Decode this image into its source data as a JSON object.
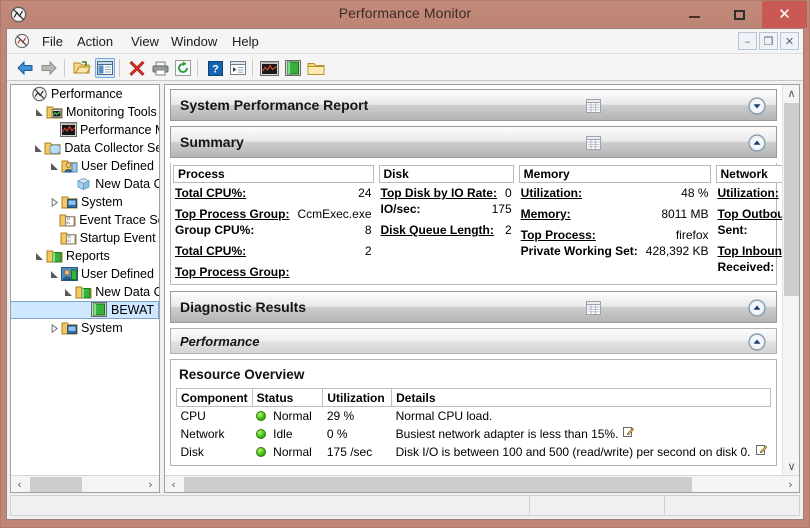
{
  "window": {
    "title": "Performance Monitor",
    "icon": "performance-monitor-icon",
    "minimize": "–",
    "maximize": "❑",
    "close": "✕"
  },
  "menu": {
    "items": [
      {
        "label": "File"
      },
      {
        "label": "Action"
      },
      {
        "label": "View"
      },
      {
        "label": "Window"
      },
      {
        "label": "Help"
      }
    ],
    "mdi_buttons": [
      {
        "name": "mdi-minimize-button",
        "glyph": "–"
      },
      {
        "name": "mdi-restore-button",
        "glyph": "❐"
      },
      {
        "name": "mdi-close-button",
        "glyph": "✕"
      }
    ]
  },
  "toolbar": {
    "items": [
      {
        "name": "back-button",
        "icon": "back-arrow-icon"
      },
      {
        "name": "forward-button",
        "icon": "forward-arrow-icon"
      },
      {
        "name": "open-folder-button",
        "icon": "open-folder-icon"
      },
      {
        "name": "show-console-tree-button",
        "icon": "console-tree-icon",
        "selected": true
      },
      {
        "name": "delete-button",
        "icon": "red-x-icon"
      },
      {
        "name": "print-button",
        "icon": "printer-icon"
      },
      {
        "name": "refresh-button",
        "icon": "refresh-icon"
      },
      {
        "name": "help-button",
        "icon": "question-mark-icon"
      },
      {
        "name": "properties-button",
        "icon": "properties-icon"
      },
      {
        "name": "performance-monitor-button",
        "icon": "performance-graph-icon"
      },
      {
        "name": "report-button",
        "icon": "green-report-icon"
      },
      {
        "name": "new-folder-button",
        "icon": "yellow-folder-icon"
      }
    ]
  },
  "tree": {
    "nodes": [
      {
        "label": "Performance",
        "indent": 0,
        "expander": "none",
        "icon": "performance-root-icon",
        "selected": false
      },
      {
        "label": "Monitoring Tools",
        "indent": 1,
        "expander": "expanded",
        "icon": "folder-green-graph-icon",
        "selected": false
      },
      {
        "label": "Performance M",
        "indent": 2,
        "expander": "none",
        "icon": "perf-monitor-graph-icon",
        "selected": false
      },
      {
        "label": "Data Collector Sets",
        "indent": 1,
        "expander": "expanded",
        "icon": "folder-collector-icon",
        "selected": false
      },
      {
        "label": "User Defined",
        "indent": 2,
        "expander": "expanded",
        "icon": "user-defined-icon",
        "selected": false
      },
      {
        "label": "New Data C",
        "indent": 3,
        "expander": "none",
        "icon": "data-collector-cube-icon",
        "selected": false
      },
      {
        "label": "System",
        "indent": 2,
        "expander": "collapsed",
        "icon": "folder-system-icon",
        "selected": false
      },
      {
        "label": "Event Trace Ses",
        "indent": 2,
        "expander": "none",
        "icon": "folder-event-trace-icon",
        "selected": false
      },
      {
        "label": "Startup Event T",
        "indent": 2,
        "expander": "none",
        "icon": "folder-event-trace-icon",
        "selected": false
      },
      {
        "label": "Reports",
        "indent": 1,
        "expander": "expanded",
        "icon": "folder-reports-icon",
        "selected": false
      },
      {
        "label": "User Defined",
        "indent": 2,
        "expander": "expanded",
        "icon": "reports-user-defined-icon",
        "selected": false
      },
      {
        "label": "New Data C",
        "indent": 3,
        "expander": "expanded",
        "icon": "folder-reports-icon",
        "selected": false
      },
      {
        "label": "BEWAT",
        "indent": 4,
        "expander": "none",
        "icon": "green-report-icon",
        "selected": true
      },
      {
        "label": "System",
        "indent": 2,
        "expander": "collapsed",
        "icon": "folder-system-icon",
        "selected": false
      }
    ]
  },
  "report": {
    "main_header": {
      "title": "System Performance Report",
      "collapsed": true
    },
    "summary": {
      "title": "Summary",
      "collapsed": false,
      "columns": [
        {
          "header": "Process",
          "rows": [
            {
              "key": "Total CPU%:",
              "value": "24",
              "style": "underline"
            },
            {
              "key": "",
              "value": "",
              "style": "gap"
            },
            {
              "key": "Top Process Group:",
              "value": "CcmExec.exe",
              "style": "underline"
            },
            {
              "key": "Group CPU%:",
              "value": "8",
              "style": "bold"
            },
            {
              "key": "",
              "value": "",
              "style": "gap"
            },
            {
              "key": "Total CPU%:",
              "value": "2",
              "style": "underline"
            },
            {
              "key": "",
              "value": "",
              "style": "gap"
            },
            {
              "key": "Top Process Group:",
              "value": "",
              "style": "underline"
            }
          ]
        },
        {
          "header": "Disk",
          "rows": [
            {
              "key": "Top Disk by IO Rate:",
              "value": "0",
              "style": "underline"
            },
            {
              "key": "IO/sec:",
              "value": "175",
              "style": "bold"
            },
            {
              "key": "",
              "value": "",
              "style": "gap"
            },
            {
              "key": "Disk Queue Length:",
              "value": "2",
              "style": "underline"
            }
          ]
        },
        {
          "header": "Memory",
          "rows": [
            {
              "key": "Utilization:",
              "value": "48 %",
              "style": "underline"
            },
            {
              "key": "",
              "value": "",
              "style": "gap"
            },
            {
              "key": "Memory:",
              "value": "8011 MB",
              "style": "underline"
            },
            {
              "key": "",
              "value": "",
              "style": "gap"
            },
            {
              "key": "Top Process:",
              "value": "firefox",
              "style": "underline"
            },
            {
              "key": "Private Working Set:",
              "value": "428,392 KB",
              "style": "bold"
            }
          ]
        },
        {
          "header": "Network",
          "rows": [
            {
              "key": "Utilization:",
              "value": "",
              "style": "underline"
            },
            {
              "key": "",
              "value": "",
              "style": "gap"
            },
            {
              "key": "Top Outbound Client:",
              "value": "",
              "style": "underline"
            },
            {
              "key": "Sent:",
              "value": "",
              "style": "bold"
            },
            {
              "key": "",
              "value": "",
              "style": "gap"
            },
            {
              "key": "Top Inbound Client:",
              "value": "",
              "style": "underline"
            },
            {
              "key": "Received:",
              "value": "",
              "style": "bold"
            }
          ]
        }
      ]
    },
    "diagnostic_results": {
      "title": "Diagnostic Results",
      "collapsed": false
    },
    "performance": {
      "title": "Performance",
      "collapsed": false
    },
    "resource_overview": {
      "title": "Resource Overview",
      "headers": [
        "Component",
        "Status",
        "Utilization",
        "Details"
      ],
      "rows": [
        {
          "component": "CPU",
          "status": "Normal",
          "utilization": "29 %",
          "details": "Normal CPU load.",
          "has_note": false
        },
        {
          "component": "Network",
          "status": "Idle",
          "utilization": "0 %",
          "details": "Busiest network adapter is less than 15%.",
          "has_note": true
        },
        {
          "component": "Disk",
          "status": "Normal",
          "utilization": "175 /sec",
          "details": "Disk I/O is between 100 and 500 (read/write) per second on disk 0.",
          "has_note": true
        }
      ]
    }
  },
  "scrollbars": {
    "left_h": {
      "left_arrow": "‹",
      "right_arrow": "›"
    },
    "right_h": {
      "left_arrow": "‹",
      "right_arrow": "›"
    },
    "right_v": {
      "up_arrow": "∧",
      "down_arrow": "∨"
    }
  },
  "colors": {
    "window_frame": "#c08778",
    "close_button": "#c95a53",
    "selection": "#cde8ff",
    "status_led_green": "#44c117",
    "toolbar_selected": "#d6e7f8"
  }
}
